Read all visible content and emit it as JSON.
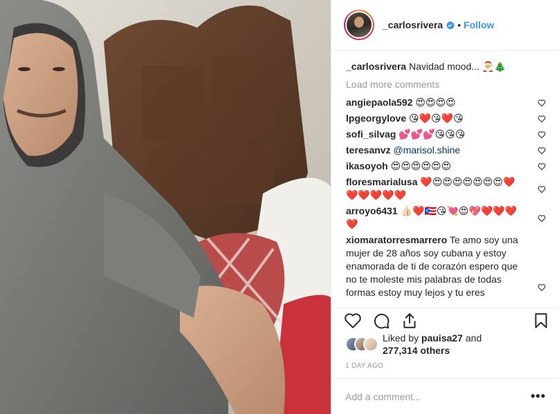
{
  "post": {
    "username": "_carlosrivera",
    "separator": "•",
    "follow_label": "Follow",
    "caption_user": "_carlosrivera",
    "caption_text": "Navidad mood... 🎅🎄",
    "load_more": "Load more comments",
    "comments": [
      {
        "user": "angiepaola592",
        "text": "😍😍😍😍"
      },
      {
        "user": "lpgeorgylove",
        "text": "😘❤️😘❤️😘"
      },
      {
        "user": "sofi_silvag",
        "text": "💕💕💕😘😘😘"
      },
      {
        "user": "teresanvz",
        "text": "@marisol.shine"
      },
      {
        "user": "ikasoyoh",
        "text": "😍😍😍😍😍😍"
      },
      {
        "user": "floresmarialusa",
        "text": "❤️😍😍😍😍😍😍😍❤️❤️❤️❤️❤️❤️"
      },
      {
        "user": "arroyo6431",
        "text": "👍🏻❤️🇵🇷😘💘😍💖❤️❤️❤️❤️"
      },
      {
        "user": "xiomaratorresmarrero",
        "text": "Te amo soy una mujer de 28 años soy cubana y estoy enamorada de ti de corazón espero que no te moleste mis palabras de todas formas estoy muy lejos y tu eres"
      }
    ],
    "likes_prefix": "Liked by ",
    "likes_user": "pauisa27",
    "likes_mid": " and",
    "likes_count": "277,314 others",
    "timestamp": "1 DAY AGO",
    "add_comment_placeholder": "Add a comment...",
    "more_label": "•••"
  },
  "icons": {
    "verified": "verified-badge-icon",
    "comment_like": "heart-outline-icon",
    "like": "heart-outline-icon",
    "comment": "comment-bubble-icon",
    "share": "share-icon",
    "save": "bookmark-icon"
  },
  "colors": {
    "link_blue": "#3897f0",
    "text": "#262626",
    "muted": "#999999",
    "border": "#efefef",
    "mention": "#003569"
  }
}
